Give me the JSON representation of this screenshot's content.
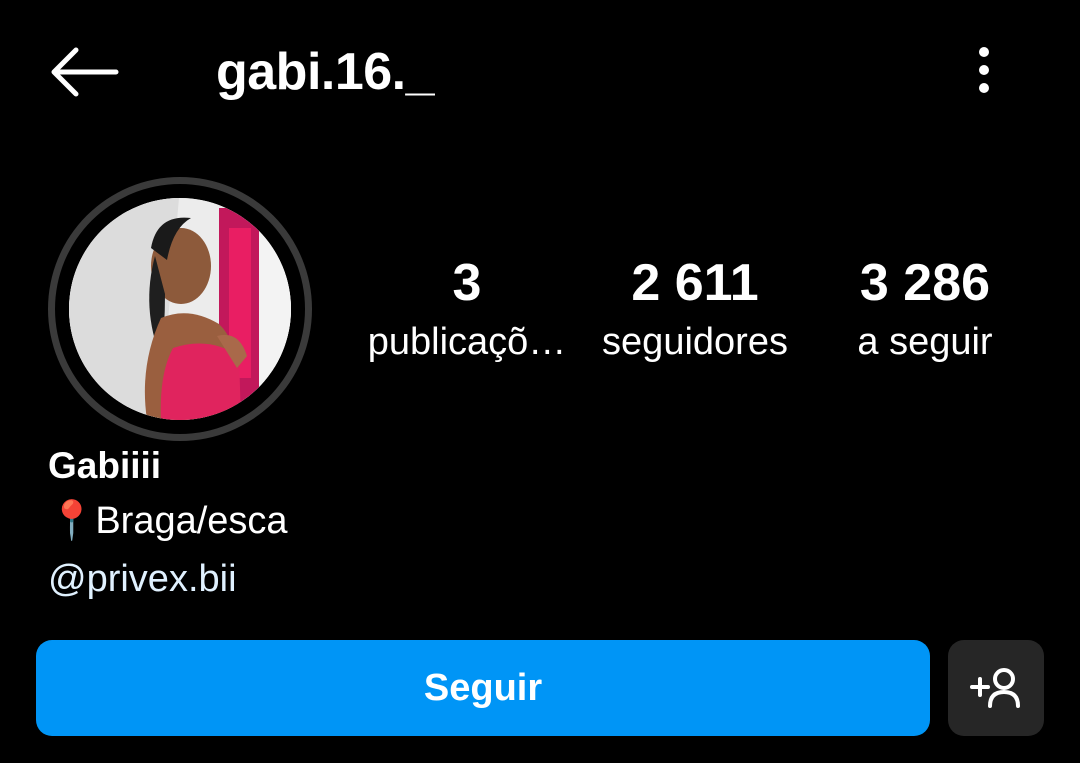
{
  "header": {
    "username": "gabi.16._",
    "back_icon": "arrow-left-icon",
    "more_icon": "more-vertical-icon"
  },
  "profile": {
    "avatar_alt": "profile-photo",
    "stats": [
      {
        "value": "3",
        "label": "publicaçõ…"
      },
      {
        "value": "2 611",
        "label": "seguidores"
      },
      {
        "value": "3 286",
        "label": "a seguir"
      }
    ]
  },
  "bio": {
    "name": "Gabiiii",
    "location_emoji": "📍",
    "location_text": "Braga/esca",
    "link": "@privex.bii"
  },
  "actions": {
    "follow_label": "Seguir",
    "suggest_icon": "add-person-icon"
  },
  "colors": {
    "background": "#000000",
    "primary_button": "#0095f6",
    "secondary_button": "#262626",
    "avatar_ring": "#3a3a3a"
  }
}
